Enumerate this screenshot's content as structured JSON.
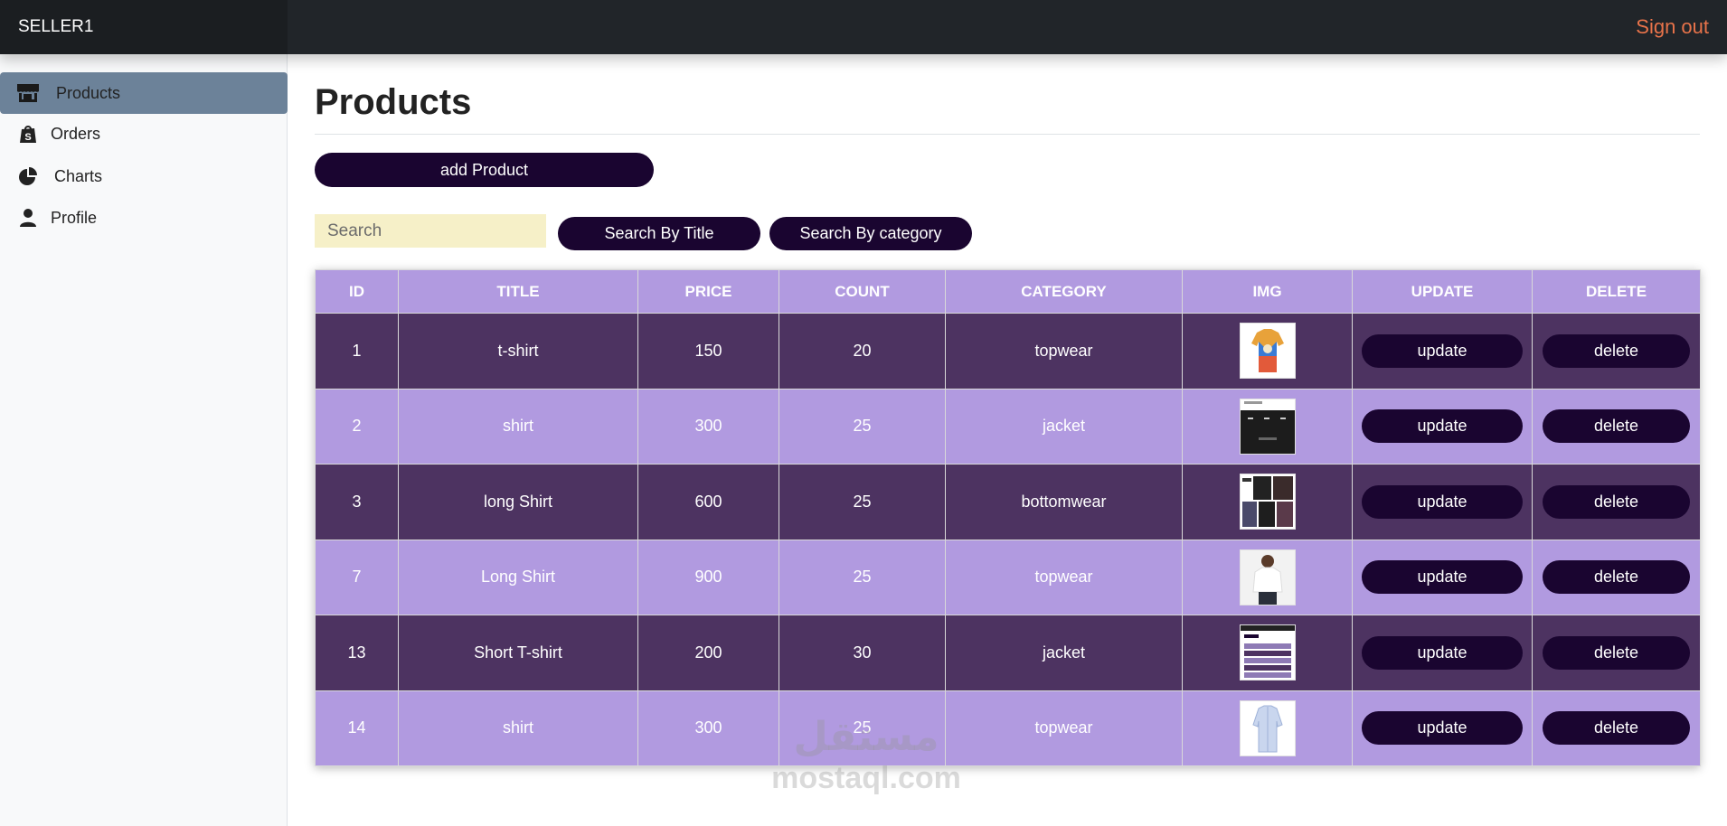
{
  "header": {
    "brand": "SELLER1",
    "signout_label": "Sign out",
    "signout_color": "#e8734a"
  },
  "sidebar": {
    "items": [
      {
        "label": "Products",
        "icon": "store-icon",
        "active": true
      },
      {
        "label": "Orders",
        "icon": "shopify-bag-icon",
        "active": false
      },
      {
        "label": "Charts",
        "icon": "pie-chart-icon",
        "active": false
      },
      {
        "label": "Profile",
        "icon": "user-icon",
        "active": false
      }
    ]
  },
  "main": {
    "page_title": "Products",
    "add_button_label": "add Product",
    "search_placeholder": "Search",
    "search_by_title_label": "Search By Title",
    "search_by_category_label": "Search By category"
  },
  "table": {
    "headers": [
      "ID",
      "TITLE",
      "PRICE",
      "COUNT",
      "CATEGORY",
      "IMG",
      "UPDATE",
      "DELETE"
    ],
    "rows": [
      {
        "id": "1",
        "title": "t-shirt",
        "price": "150",
        "count": "20",
        "category": "topwear",
        "img": "colorful-shirt-thumbnail",
        "update": "update",
        "delete": "delete"
      },
      {
        "id": "2",
        "title": "shirt",
        "price": "300",
        "count": "25",
        "category": "jacket",
        "img": "dark-screenshot-thumbnail",
        "update": "update",
        "delete": "delete"
      },
      {
        "id": "3",
        "title": "long Shirt",
        "price": "600",
        "count": "25",
        "category": "bottomwear",
        "img": "fashion-grid-thumbnail",
        "update": "update",
        "delete": "delete"
      },
      {
        "id": "7",
        "title": "Long Shirt",
        "price": "900",
        "count": "25",
        "category": "topwear",
        "img": "woman-white-shirt-thumbnail",
        "update": "update",
        "delete": "delete"
      },
      {
        "id": "13",
        "title": "Short T-shirt",
        "price": "200",
        "count": "30",
        "category": "jacket",
        "img": "table-screenshot-thumbnail",
        "update": "update",
        "delete": "delete"
      },
      {
        "id": "14",
        "title": "shirt",
        "price": "300",
        "count": "25",
        "category": "topwear",
        "img": "blue-shirt-thumbnail",
        "update": "update",
        "delete": "delete"
      }
    ]
  },
  "colors": {
    "topbar": "#212529",
    "sidebar_active": "#6c8299",
    "button_dark": "#1a0530",
    "row_dark": "#4d3361",
    "row_light": "#b19ae0",
    "search_bg": "#f6f0c8"
  },
  "watermark": {
    "arabic": "مستقل",
    "latin": "mostaql.com"
  }
}
